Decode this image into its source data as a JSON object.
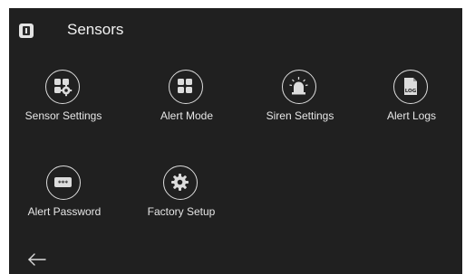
{
  "header": {
    "title": "Sensors",
    "icon": "app-info-icon"
  },
  "menu": {
    "items": [
      {
        "label": "Sensor Settings",
        "icon": "sensor-settings-icon"
      },
      {
        "label": "Alert Mode",
        "icon": "alert-mode-icon"
      },
      {
        "label": "Siren Settings",
        "icon": "siren-icon"
      },
      {
        "label": "Alert Logs",
        "icon": "log-icon"
      },
      {
        "label": "Alert Password",
        "icon": "password-icon"
      },
      {
        "label": "Factory Setup",
        "icon": "gear-icon"
      }
    ]
  },
  "log_icon_text": "LOG",
  "password_icon_text": "***",
  "footer": {
    "back_icon": "back-arrow-icon"
  },
  "colors": {
    "background": "#202020",
    "text": "#ececec",
    "icon": "#dcdcdc"
  }
}
